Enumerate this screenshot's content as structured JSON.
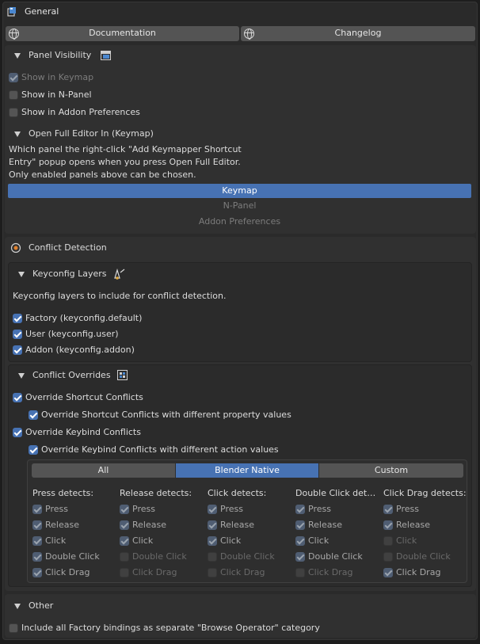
{
  "header": {
    "title": "General"
  },
  "links": {
    "documentation": "Documentation",
    "changelog": "Changelog"
  },
  "panel_visibility": {
    "title": "Panel Visibility",
    "show_keymap": "Show in Keymap",
    "show_npanel": "Show in N-Panel",
    "show_addon_prefs": "Show in Addon Preferences"
  },
  "open_full_editor": {
    "title": "Open Full Editor In (Keymap)",
    "desc1": "Which panel the right-click \"Add Keymapper Shortcut",
    "desc2": "Entry\" popup opens when you press Open Full Editor.",
    "desc3": "Only enabled panels above can be chosen.",
    "options": [
      "Keymap",
      "N-Panel",
      "Addon Preferences"
    ],
    "selected": "Keymap"
  },
  "conflict_detection": {
    "title": "Conflict Detection"
  },
  "keyconfig_layers": {
    "title": "Keyconfig Layers",
    "desc": "Keyconfig layers to include for conflict detection.",
    "factory": "Factory (keyconfig.default)",
    "user": "User (keyconfig.user)",
    "addon": "Addon (keyconfig.addon)"
  },
  "conflict_overrides": {
    "title": "Conflict Overrides",
    "override_shortcut": "Override Shortcut Conflicts",
    "override_shortcut_props": "Override Shortcut Conflicts with different property values",
    "override_keybind": "Override Keybind Conflicts",
    "override_keybind_actions": "Override Keybind Conflicts with different action values",
    "modes": [
      "All",
      "Blender Native",
      "Custom"
    ],
    "active_mode": "Blender Native",
    "columns": [
      {
        "header": "Press detects:",
        "items": [
          {
            "label": "Press",
            "checked": true
          },
          {
            "label": "Release",
            "checked": true
          },
          {
            "label": "Click",
            "checked": true
          },
          {
            "label": "Double Click",
            "checked": true
          },
          {
            "label": "Click Drag",
            "checked": true
          }
        ]
      },
      {
        "header": "Release detects:",
        "items": [
          {
            "label": "Press",
            "checked": true
          },
          {
            "label": "Release",
            "checked": true
          },
          {
            "label": "Click",
            "checked": true
          },
          {
            "label": "Double Click",
            "checked": false
          },
          {
            "label": "Click Drag",
            "checked": false
          }
        ]
      },
      {
        "header": "Click detects:",
        "items": [
          {
            "label": "Press",
            "checked": true
          },
          {
            "label": "Release",
            "checked": true
          },
          {
            "label": "Click",
            "checked": true
          },
          {
            "label": "Double Click",
            "checked": false
          },
          {
            "label": "Click Drag",
            "checked": false
          }
        ]
      },
      {
        "header": "Double Click det…",
        "items": [
          {
            "label": "Press",
            "checked": true
          },
          {
            "label": "Release",
            "checked": true
          },
          {
            "label": "Click",
            "checked": true
          },
          {
            "label": "Double Click",
            "checked": true
          },
          {
            "label": "Click Drag",
            "checked": false
          }
        ]
      },
      {
        "header": "Click Drag detects:",
        "items": [
          {
            "label": "Press",
            "checked": true
          },
          {
            "label": "Release",
            "checked": true
          },
          {
            "label": "Click",
            "checked": false
          },
          {
            "label": "Double Click",
            "checked": false
          },
          {
            "label": "Click Drag",
            "checked": true
          }
        ]
      }
    ]
  },
  "other": {
    "title": "Other",
    "include_factory": "Include all Factory bindings as separate \"Browse Operator\" category"
  }
}
